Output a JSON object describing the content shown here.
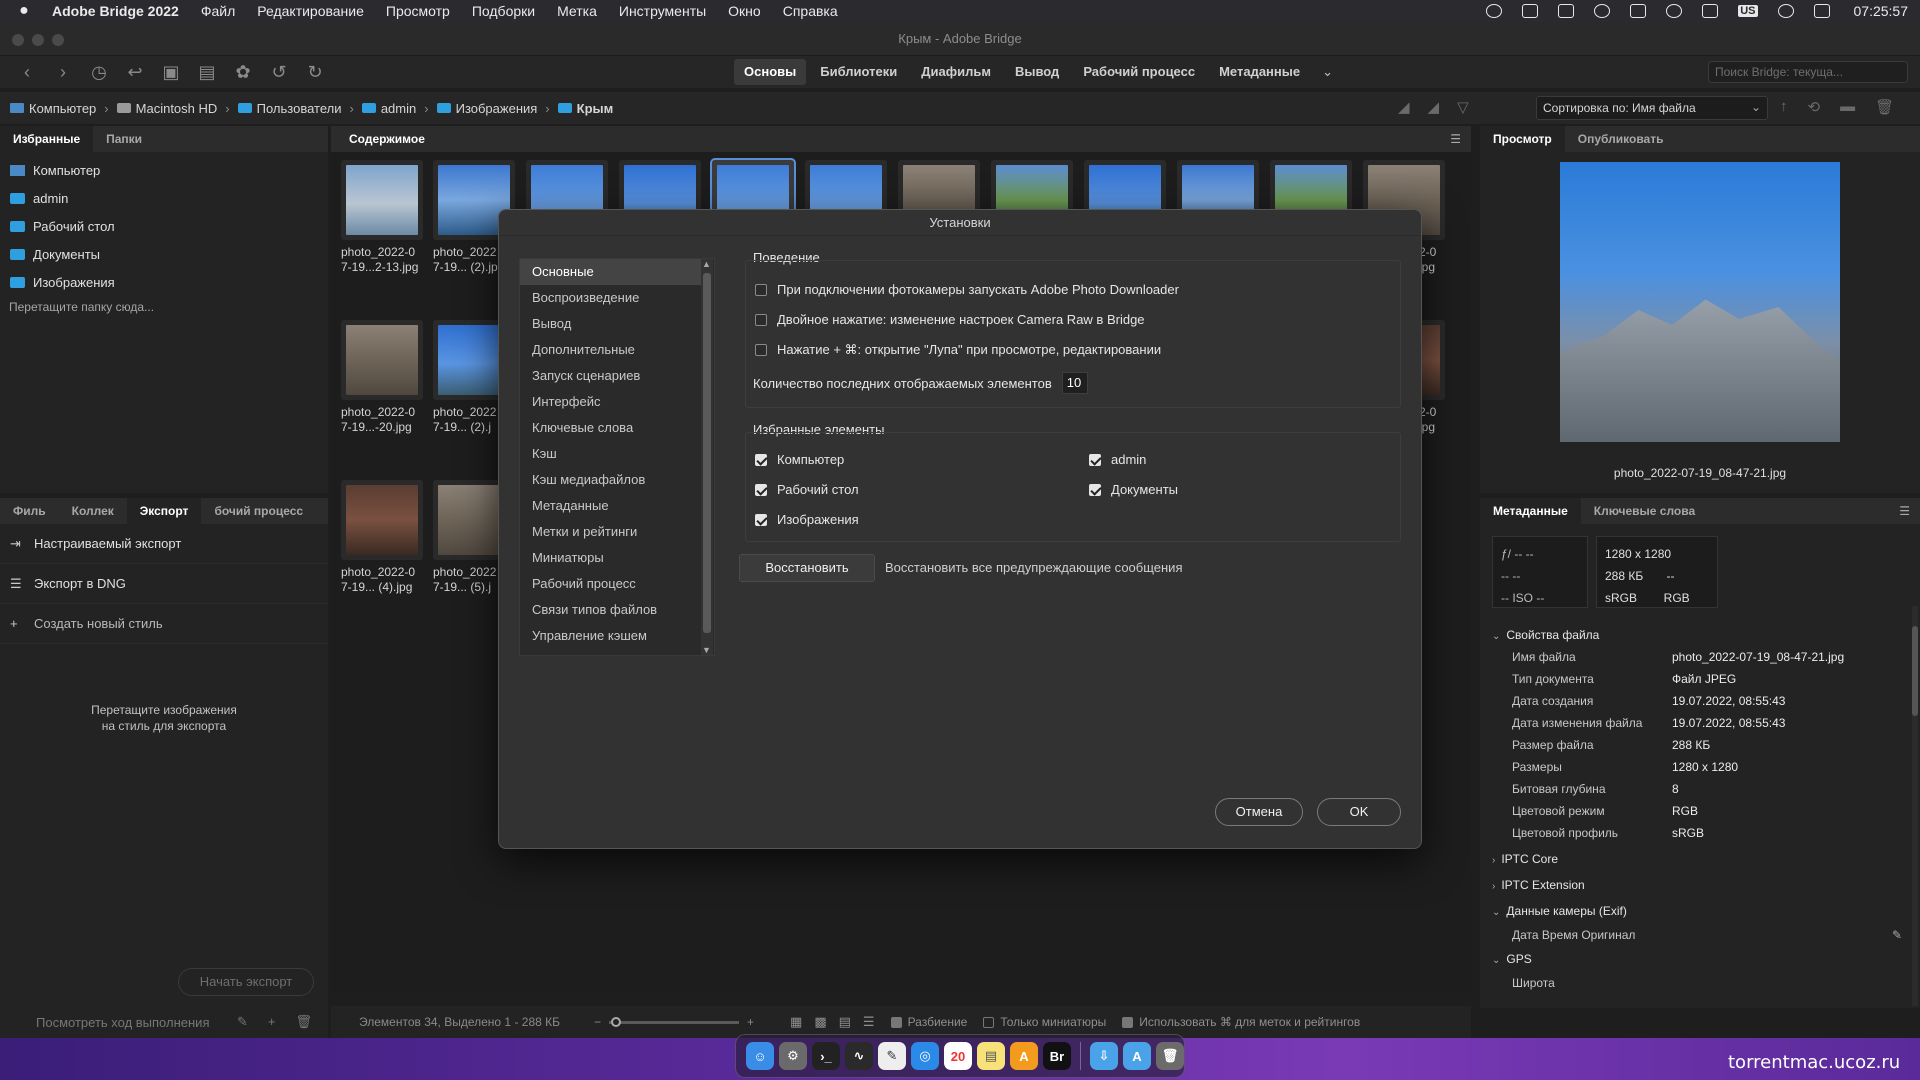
{
  "menubar": {
    "apple": "",
    "app_name": "Adobe Bridge 2022",
    "items": [
      "Файл",
      "Редактирование",
      "Просмотр",
      "Подборки",
      "Метка",
      "Инструменты",
      "Окно",
      "Справка"
    ],
    "clock": "07:25:57",
    "input_source": "US"
  },
  "window": {
    "title": "Крым - Adobe Bridge"
  },
  "workspaces": {
    "tabs": [
      "Основы",
      "Библиотеки",
      "Диафильм",
      "Вывод",
      "Рабочий процесс",
      "Метаданные"
    ],
    "active": "Основы",
    "search_placeholder": "Поиск Bridge: текуща..."
  },
  "path": {
    "crumbs": [
      "Компьютер",
      "Macintosh HD",
      "Пользователи",
      "admin",
      "Изображения",
      "Крым"
    ],
    "sort_label": "Сортировка по: Имя файла"
  },
  "left_top": {
    "tabs": [
      "Избранные",
      "Папки"
    ],
    "favorites": [
      "Компьютер",
      "admin",
      "Рабочий стол",
      "Документы",
      "Изображения"
    ],
    "drop_hint": "Перетащите папку сюда..."
  },
  "left_bottom": {
    "tabs": [
      "Филь",
      "Коллек",
      "Экспорт",
      "бочий процесс"
    ],
    "items": [
      "Настраиваемый экспорт",
      "Экспорт в DNG",
      "Создать новый стиль"
    ],
    "hint_line1": "Перетащите изображения",
    "hint_line2": "на стиль для экспорта",
    "start_button": "Начать экспорт",
    "progress_link": "Посмотреть ход выполнения"
  },
  "content": {
    "title": "Содержимое",
    "captions": [
      [
        "photo_2022-0",
        "7-19...2-13.jpg"
      ],
      [
        "photo_2022",
        "7-19... (2).jpg"
      ],
      [
        "photo_2022-0",
        "7-19...-20.jpg"
      ],
      [
        "photo_2022",
        "7-19... (2).j"
      ],
      [
        "photo_2022-0",
        "7-19... (4).jpg"
      ],
      [
        "photo_2022",
        "7-19... (5).j"
      ],
      [
        "2-0",
        "jpg"
      ],
      [
        "2-0",
        "jpg"
      ]
    ],
    "status": "Элементов 34, Выделено 1 - 288 КБ",
    "footer_checks": [
      "Разбиение",
      "Только миниатюры",
      "Использовать ⌘ для меток и рейтингов"
    ]
  },
  "right_top": {
    "tabs": [
      "Просмотр",
      "Опубликовать"
    ],
    "preview_filename": "photo_2022-07-19_08-47-21.jpg"
  },
  "right_bottom": {
    "tabs": [
      "Метаданные",
      "Ключевые слова"
    ],
    "box1": [
      "ƒ/ --   --",
      "--       --",
      "--     ISO --"
    ],
    "box2": [
      "1280 x 1280",
      "288 КБ       --",
      "sRGB        RGB"
    ],
    "file_props_title": "Свойства файла",
    "file_props": [
      [
        "Имя файла",
        "photo_2022-07-19_08-47-21.jpg"
      ],
      [
        "Тип документа",
        "Файл JPEG"
      ],
      [
        "Дата создания",
        "19.07.2022, 08:55:43"
      ],
      [
        "Дата изменения файла",
        "19.07.2022, 08:55:43"
      ],
      [
        "Размер файла",
        "288 КБ"
      ],
      [
        "Размеры",
        "1280 x 1280"
      ],
      [
        "Битовая глубина",
        "8"
      ],
      [
        "Цветовой режим",
        "RGB"
      ],
      [
        "Цветовой профиль",
        "sRGB"
      ]
    ],
    "iptc_core": "IPTC Core",
    "iptc_ext": "IPTC Extension",
    "exif_title": "Данные камеры (Exif)",
    "exif_row": "Дата Время Оригинал",
    "gps_title": "GPS",
    "gps_row": "Широта"
  },
  "dialog": {
    "title": "Установки",
    "categories": [
      "Основные",
      "Воспроизведение",
      "Вывод",
      "Дополнительные",
      "Запуск сценариев",
      "Интерфейс",
      "Ключевые слова",
      "Кэш",
      "Кэш медиафайлов",
      "Метаданные",
      "Метки и рейтинги",
      "Миниатюры",
      "Рабочий процесс",
      "Связи типов файлов",
      "Управление кэшем"
    ],
    "behavior_label": "Поведение",
    "opt_downloader": "При подключении фотокамеры запускать Adobe Photo Downloader",
    "opt_doubleclick": "Двойное нажатие: изменение настроек Camera Raw в Bridge",
    "opt_loupe": "Нажатие + ⌘: открытие \"Лупа\" при просмотре, редактировании",
    "recent_label": "Количество последних отображаемых элементов",
    "recent_value": "10",
    "fav_label": "Избранные элементы",
    "fav_computer": "Компьютер",
    "fav_admin": "admin",
    "fav_desktop": "Рабочий стол",
    "fav_documents": "Документы",
    "fav_images": "Изображения",
    "restore_button": "Восстановить",
    "restore_desc": "Восстановить все предупреждающие сообщения",
    "cancel": "Отмена",
    "ok": "OK"
  },
  "dock": {
    "calendar_day": "20",
    "bridge_label": "Br"
  },
  "watermark": "torrentmac.ucoz.ru"
}
